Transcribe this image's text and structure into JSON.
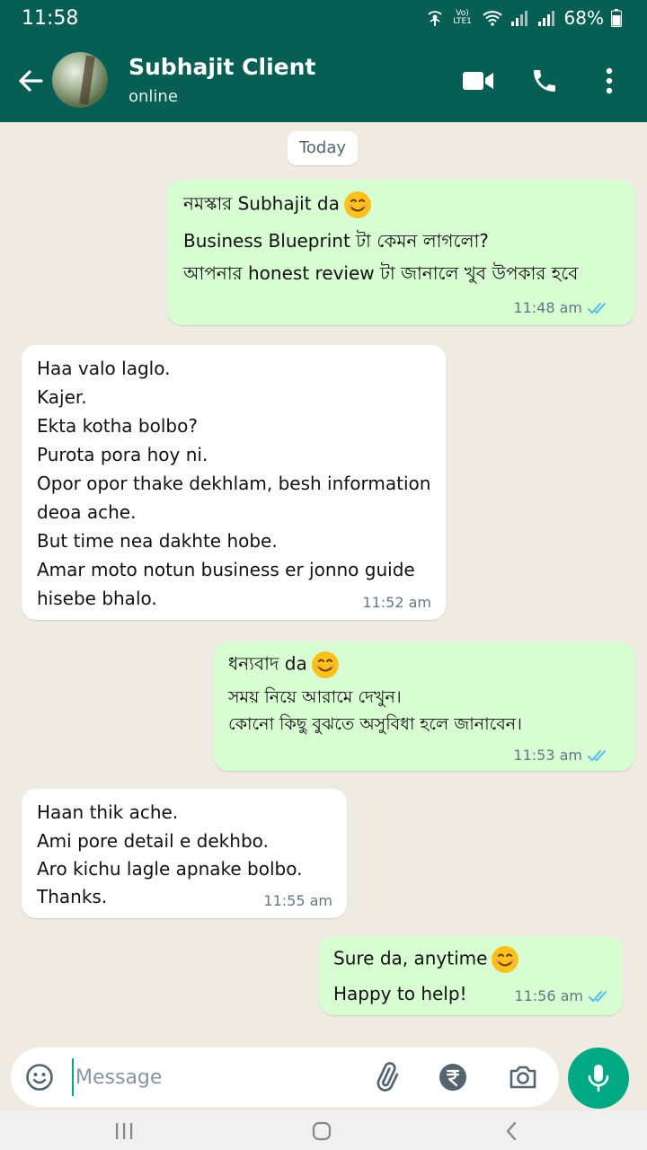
{
  "status_bar": {
    "time": "11:58",
    "network_label": "Vo) LTE1",
    "battery": "68%"
  },
  "header": {
    "contact_name": "Subhajit Client",
    "contact_status": "online"
  },
  "chat": {
    "date_chip": "Today",
    "messages": [
      {
        "direction": "out",
        "lines": [
          "নমস্কার Subhajit da",
          "Business Blueprint টা কেমন লাগলো?",
          "আপনার honest review টা জানালে খুব উপকার হবে"
        ],
        "time": "11:48 am",
        "status": "read"
      },
      {
        "direction": "in",
        "lines": [
          "Haa valo laglo.",
          "Kajer.",
          "Ekta kotha bolbo?",
          "Purota pora hoy ni.",
          "Opor opor thake dekhlam, besh information",
          "deoa ache.",
          "But time nea dakhte hobe.",
          "Amar moto notun business er jonno guide",
          "hisebe bhalo."
        ],
        "time": "11:52 am"
      },
      {
        "direction": "out",
        "lines": [
          "ধন্যবাদ da",
          "সময় নিয়ে আরামে দেখুন।",
          "কোনো কিছু বুঝতে অসুবিধা হলে জানাবেন।"
        ],
        "time": "11:53 am",
        "status": "read"
      },
      {
        "direction": "in",
        "lines": [
          "Haan thik ache.",
          "Ami pore detail e dekhbo.",
          "Aro kichu lagle apnake bolbo.",
          "Thanks."
        ],
        "time": "11:55 am"
      },
      {
        "direction": "out",
        "lines": [
          "Sure da, anytime",
          "Happy to help!"
        ],
        "time": "11:56 am",
        "status": "read"
      }
    ]
  },
  "input": {
    "placeholder": "Message"
  },
  "icons": {
    "emoji": "smiley-icon",
    "attach": "paperclip-icon",
    "payment": "rupee-icon",
    "camera": "camera-icon",
    "mic": "mic-icon",
    "video": "video-call-icon",
    "call": "phone-icon",
    "menu": "more-vert-icon",
    "back": "back-arrow-icon"
  },
  "colors": {
    "header": "#075e54",
    "outgoing": "#d9fdd3",
    "incoming": "#ffffff",
    "accent": "#00a884",
    "read_ticks": "#53bdeb",
    "wallpaper": "#efeae2"
  }
}
